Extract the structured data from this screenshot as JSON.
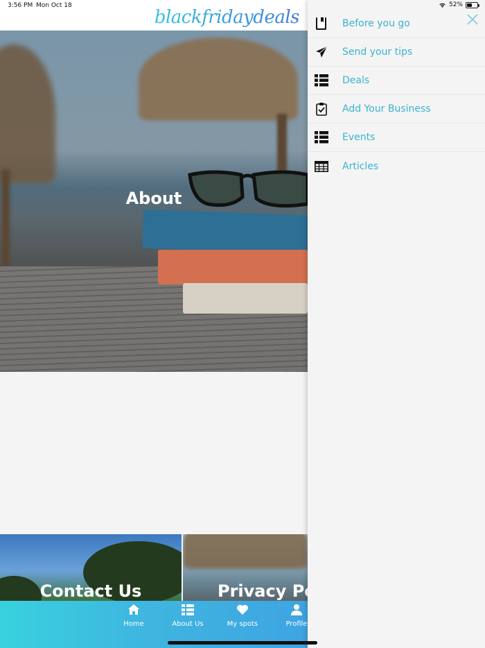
{
  "status_bar": {
    "time": "3:56 PM",
    "date": "Mon Oct 18",
    "battery": "52%"
  },
  "header": {
    "logo_text": "blackfridaydeals"
  },
  "hero": {
    "title": "About"
  },
  "tiles": [
    {
      "title": "Contact Us"
    },
    {
      "title": "Privacy Poli"
    }
  ],
  "tab_bar": {
    "items": [
      {
        "label": "Home",
        "icon": "home-icon"
      },
      {
        "label": "About Us",
        "icon": "list-icon"
      },
      {
        "label": "My spots",
        "icon": "heart-icon"
      },
      {
        "label": "Profile",
        "icon": "person-icon"
      }
    ]
  },
  "drawer": {
    "items": [
      {
        "label": "Before you go",
        "icon": "bookmark-book-icon"
      },
      {
        "label": "Send your tips",
        "icon": "paper-plane-icon"
      },
      {
        "label": "Deals",
        "icon": "list-icon"
      },
      {
        "label": "Add Your Business",
        "icon": "clipboard-check-icon"
      },
      {
        "label": "Events",
        "icon": "list-icon"
      },
      {
        "label": "Articles",
        "icon": "table-icon"
      }
    ]
  },
  "colors": {
    "accent": "#3ab4d0",
    "tab_bar_start": "#38d2de",
    "tab_bar_end": "#3ea4e2"
  }
}
